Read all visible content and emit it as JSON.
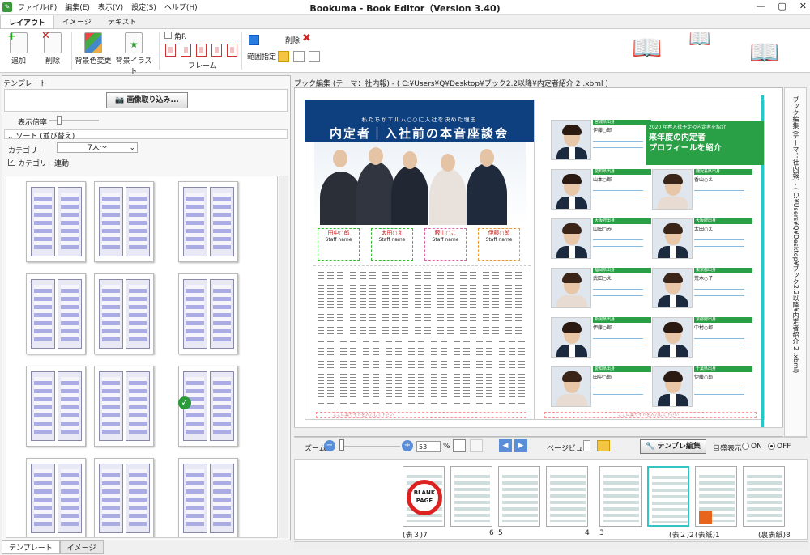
{
  "window": {
    "title": "Bookuma - Book Editor（Version 3.40)",
    "menu": [
      "ファイル(F)",
      "編集(E)",
      "表示(V)",
      "設定(S)",
      "ヘルプ(H)"
    ],
    "controls": [
      "—",
      "▢",
      "✕"
    ]
  },
  "ribbon": {
    "tabs": [
      "レイアウト",
      "イメージ",
      "テキスト"
    ],
    "add_label": "追加",
    "delete_label": "削除",
    "bgcolor_label": "背景色変更",
    "bgillust_label": "背景イラスト",
    "corner_label": "角R",
    "frame_label": "フレーム",
    "range_label": "範囲指定",
    "range_delete_label": "削除"
  },
  "left_panel": {
    "header": "テンプレート",
    "import_button": "画像取り込み...",
    "zoom_label": "表示倍率",
    "sort_label": "ソート (並び替え)",
    "category_label": "カテゴリー",
    "category_value": "7人～",
    "category_link_label": "カテゴリー連動",
    "category_link_checked": true,
    "bottom_tabs": [
      "テンプレート",
      "イメージ"
    ]
  },
  "editor": {
    "header": "ブック編集 (テーマ：社内報) - ( C:¥Users¥Q¥Desktop¥ブック2.2以降¥内定者紹介 2 .xbml )",
    "vertical_tab": "ブック編集 (テーマ：社内報) - ( C:¥Users¥Q¥Desktop¥ブック2.2以降¥内定者紹介 2 .xbml)",
    "left_page": {
      "banner_sub": "私たちがエルム○○に入社を決めた理由",
      "banner_title": "内定者｜入社前の本音座談会",
      "names": [
        "田中○郎",
        "太田○え",
        "薮山○こ",
        "伊藤○郎"
      ],
      "name_sub": "Staff name",
      "footer": "ここに集サイトを入力して下さい"
    },
    "right_page": {
      "box_line1": "2020 年春入社予定の内定者を紹介",
      "box_line2": "来年度の内定者",
      "box_line3": "プロフィールを紹介",
      "cards": [
        {
          "region": "宮城県出身",
          "name": "伊藤○郎"
        },
        {
          "region": "愛知県出身",
          "name": "山本○郎"
        },
        {
          "region": "鹿児島県出身",
          "name": "香山○え"
        },
        {
          "region": "大阪府出身",
          "name": "山田○み"
        },
        {
          "region": "大阪府出身",
          "name": "太田○え"
        },
        {
          "region": "福岡県出身",
          "name": "武田○え"
        },
        {
          "region": "東京都出身",
          "name": "荒木○子"
        },
        {
          "region": "新潟県出身",
          "name": "伊藤○郎"
        },
        {
          "region": "京都府出身",
          "name": "中村○郎"
        },
        {
          "region": "愛知県出身",
          "name": "田中○郎"
        },
        {
          "region": "千葉県出身",
          "name": "伊藤○郎"
        }
      ],
      "footer": "ここに集サイトを入力して下さい"
    }
  },
  "zoom_bar": {
    "zoom_label": "ズーム",
    "zoom_value": "53",
    "percent": "%",
    "page_view_label": "ページビュー",
    "template_edit_button": "テンプレ編集",
    "grid_label": "目盛表示",
    "on_label": "ON",
    "off_label": "OFF",
    "grid_selected": "OFF"
  },
  "page_strip": {
    "blank_text": "BLANK PAGE",
    "labels": [
      "(表３)7",
      "6",
      "5",
      "4",
      "3",
      "(表２)2",
      "(表紙)1",
      "(裏表紙)8"
    ]
  }
}
